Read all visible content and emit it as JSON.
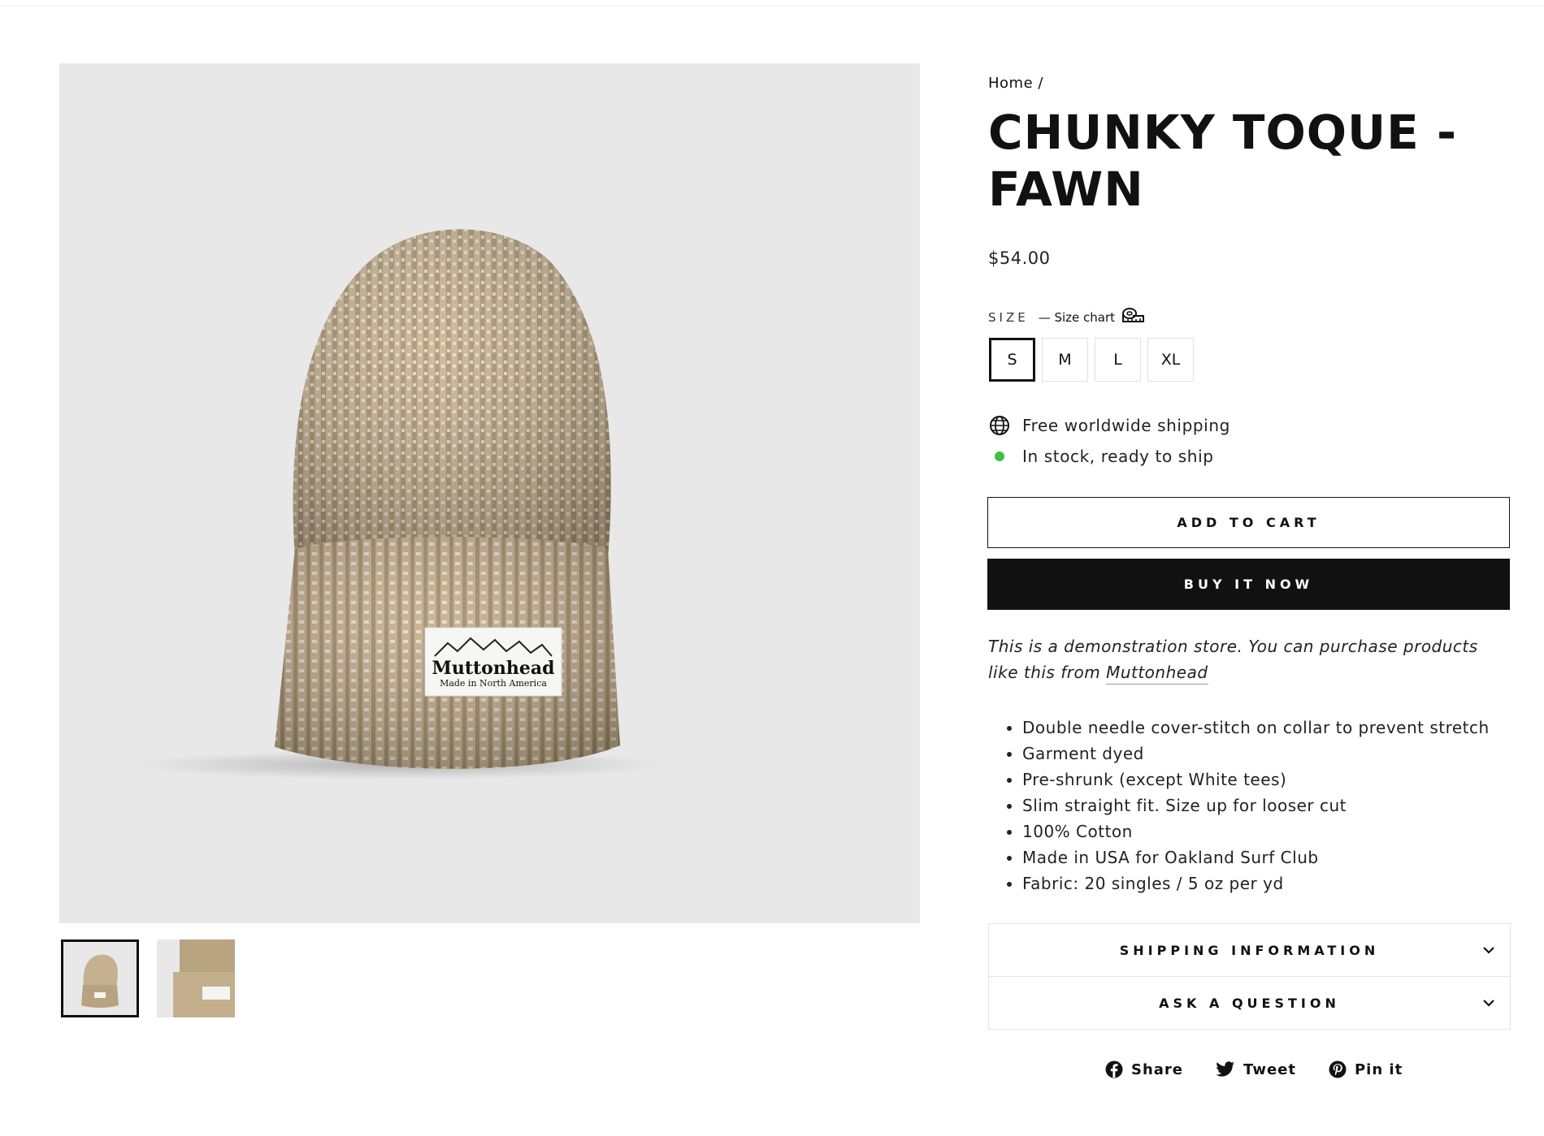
{
  "breadcrumb": {
    "home": "Home",
    "separator": "/"
  },
  "product": {
    "title": "CHUNKY TOQUE - FAWN",
    "price": "$54.00",
    "image_label": {
      "brand": "Muttonhead",
      "sub": "Made in North America"
    }
  },
  "gallery": {
    "thumbnail_count": 2,
    "selected_index": 0
  },
  "size": {
    "label": "SIZE",
    "chart_link": "— Size chart",
    "chart_icon": "ruler-icon",
    "options": [
      "S",
      "M",
      "L",
      "XL"
    ],
    "selected": "S"
  },
  "shipping": {
    "text": "Free worldwide shipping",
    "icon": "globe-icon"
  },
  "stock": {
    "text": "In stock, ready to ship",
    "color": "#40c03f"
  },
  "buttons": {
    "add_to_cart": "ADD TO CART",
    "buy_now": "BUY IT NOW"
  },
  "description": {
    "note_prefix": "This is a demonstration store. You can purchase products like this from ",
    "note_link": "Muttonhead",
    "features": [
      "Double needle cover-stitch on collar to prevent stretch",
      "Garment dyed",
      "Pre-shrunk (except White tees)",
      "Slim straight fit. Size up for looser cut",
      "100% Cotton",
      "Made in USA for Oakland Surf Club",
      "Fabric: 20 singles / 5 oz per yd"
    ]
  },
  "accordion": [
    {
      "label": "SHIPPING INFORMATION",
      "icon": "chevron-down-icon"
    },
    {
      "label": "ASK A QUESTION",
      "icon": "chevron-down-icon"
    }
  ],
  "social": [
    {
      "label": "Share",
      "icon": "facebook-icon"
    },
    {
      "label": "Tweet",
      "icon": "twitter-icon"
    },
    {
      "label": "Pin it",
      "icon": "pinterest-icon"
    }
  ],
  "colors": {
    "beanie": "#c5b08f",
    "background": "#e8e8e8",
    "primary": "#111111"
  }
}
